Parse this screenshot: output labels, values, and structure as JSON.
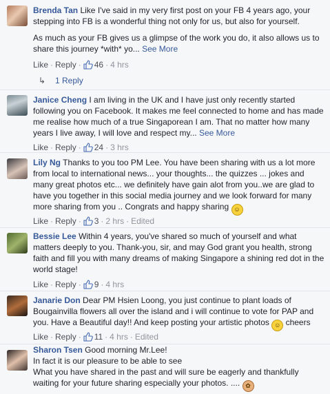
{
  "comments": [
    {
      "name": "Brenda Tan",
      "text": "Like I've said in my very first post on your FB 4 years ago, your stepping into FB is a wonderful thing not only for us, but also for yourself.",
      "text2": "As much as your FB gives us a glimpse of the work you do, it also allows us to share this journey *with* yo...",
      "see_more": "See More",
      "like": "Like",
      "reply": "Reply",
      "likes": "46",
      "time": "4 hrs",
      "replies_label": "1 Reply"
    },
    {
      "name": "Janice Cheng",
      "text": "I am living in the UK and I have just only recently started following you on Facebook. It makes me feel connected to home and has made me realise how much of a true Singaporean I am. That no matter how many years I live away, I will love and respect my...",
      "see_more": "See More",
      "like": "Like",
      "reply": "Reply",
      "likes": "24",
      "time": "3 hrs"
    },
    {
      "name": "Lily Ng",
      "text": "Thanks to you too PM Lee. You have been sharing with us a lot more from local to international news... your thoughts... the quizzes ... jokes and many great photos etc... we definitely have gain alot from you..we are glad to have you together in this social media journey and we look forward for many more sharing from you .. Congrats and happy sharing",
      "like": "Like",
      "reply": "Reply",
      "likes": "3",
      "time": "2 hrs",
      "edited": "Edited"
    },
    {
      "name": "Bessie Lee",
      "text": "Within 4 years, you've shared so much of yourself and what matters deeply to you. Thank-you, sir, and may God grant you health, strong faith and fill you with many dreams of making Singapore a shining red dot in the world stage!",
      "like": "Like",
      "reply": "Reply",
      "likes": "9",
      "time": "4 hrs"
    },
    {
      "name": "Janarie Don",
      "text": "Dear PM Hsien Loong, you just continue to plant loads of Bougainvilla flowers all over the island and i will continue to vote for PAP and you. Have a Beautiful day!! And keep posting your artistic photos",
      "text_end": "cheers",
      "like": "Like",
      "reply": "Reply",
      "likes": "11",
      "time": "4 hrs",
      "edited": "Edited"
    },
    {
      "name": "Sharon Tsen",
      "text": "Good morning Mr.Lee!",
      "text2": "In fact it is our pleasure to be able to see",
      "text3": "What you have shared in the past and will sure be eagerly and thankfully waiting for your future sharing especially your photos. ...."
    }
  ],
  "colors": {
    "link": "#365899",
    "meta": "#90949c",
    "like_blue": "#4267b2"
  },
  "icons": {
    "like": "thumbs-up-icon",
    "reply": "reply-arrow-icon",
    "emoji": "smiley-emoji-icon"
  }
}
